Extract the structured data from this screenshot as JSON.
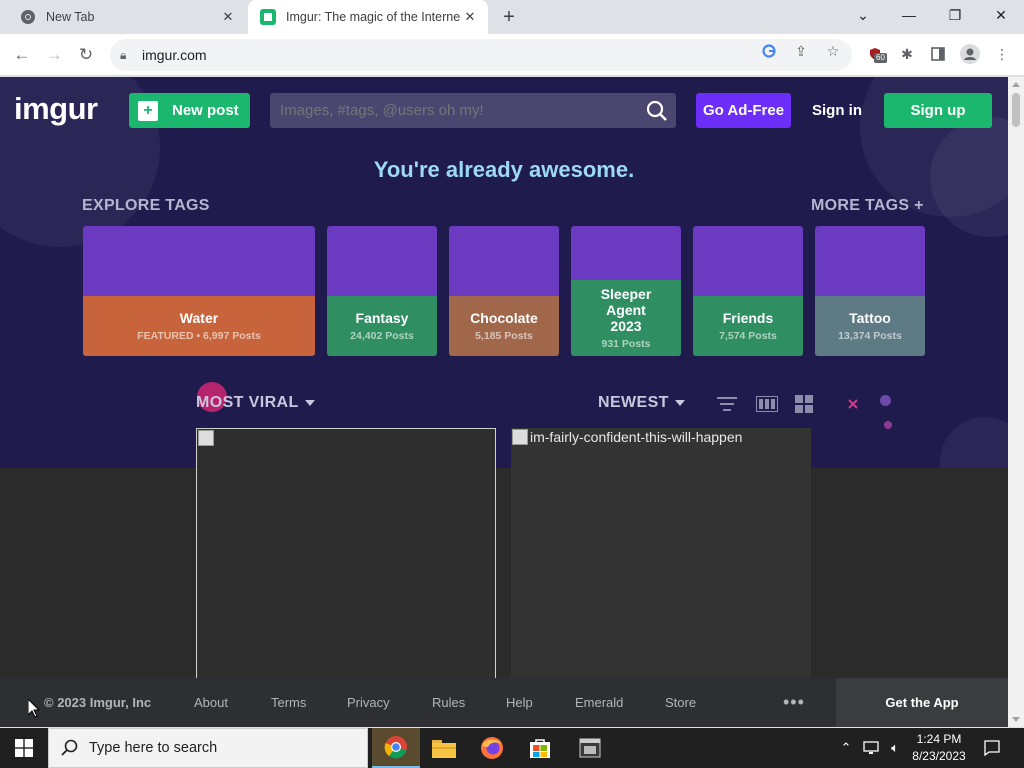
{
  "browser": {
    "tabs": [
      {
        "title": "New Tab",
        "active": false
      },
      {
        "title": "Imgur: The magic of the Internet",
        "active": true
      }
    ],
    "new_tab_symbol": "+",
    "url": "imgur.com",
    "extension_badge": "60"
  },
  "imgur": {
    "logo": "imgur",
    "new_post_label": "New post",
    "search_placeholder": "Images, #tags, @users oh my!",
    "ad_free_label": "Go Ad-Free",
    "sign_in_label": "Sign in",
    "sign_up_label": "Sign up",
    "tagline": "You're already awesome.",
    "explore_tags_label": "EXPLORE TAGS",
    "more_tags_label": "MORE TAGS +",
    "tags": [
      {
        "name": "Water",
        "count": "FEATURED • 6,997 Posts",
        "color": "#c8643b"
      },
      {
        "name": "Fantasy",
        "count": "24,402 Posts",
        "color": "#2f8f63"
      },
      {
        "name": "Chocolate",
        "count": "5,185 Posts",
        "color": "#a0674b"
      },
      {
        "name": "Sleeper Agent 2023",
        "count": "931 Posts",
        "color": "#2f8f63"
      },
      {
        "name": "Friends",
        "count": "7,574 Posts",
        "color": "#2f8f63"
      },
      {
        "name": "Tattoo",
        "count": "13,374 Posts",
        "color": "#5e7a85"
      }
    ],
    "sort_most_viral": "MOST VIRAL",
    "sort_newest": "NEWEST",
    "posts": [
      {
        "alt": ""
      },
      {
        "alt": "im-fairly-confident-this-will-happen"
      }
    ],
    "footer": {
      "copyright": "© 2023 Imgur, Inc",
      "links": [
        "About",
        "Terms",
        "Privacy",
        "Rules",
        "Help",
        "Emerald",
        "Store"
      ],
      "more": "•••",
      "get_app": "Get the App"
    },
    "colors": {
      "hero_bg": "#1f1b4d",
      "green": "#1bb76e",
      "purple": "#6b2df7",
      "tagline": "#9dd8f5"
    }
  },
  "taskbar": {
    "search_placeholder": "Type here to search",
    "time": "1:24 PM",
    "date": "8/23/2023"
  }
}
